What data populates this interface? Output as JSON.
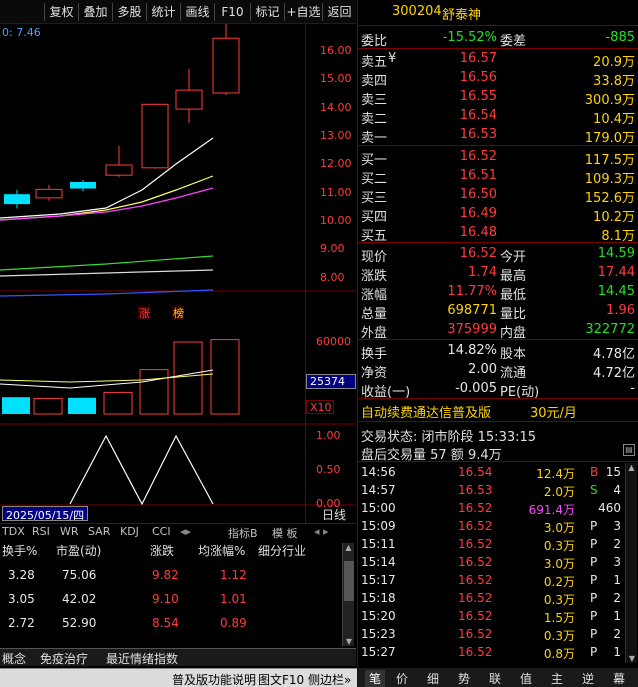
{
  "toolbar": {
    "buttons": [
      "复权",
      "叠加",
      "多股",
      "统计",
      "画线",
      "F10",
      "标记",
      "+自选",
      "返回"
    ]
  },
  "chart_data": [
    {
      "type": "candlestick",
      "title": "",
      "ma_readout": "0: 7.46",
      "yticks": [
        "16.00",
        "15.00",
        "14.00",
        "13.00",
        "12.00",
        "11.00",
        "10.00",
        "9.00",
        "8.00"
      ],
      "ylim": [
        7.5,
        16.6
      ],
      "high_label": "17.44",
      "candles": [
        {
          "o": 10.6,
          "c": 10.95,
          "h": 11.1,
          "l": 10.45,
          "color": "cyan"
        },
        {
          "o": 10.82,
          "c": 11.12,
          "h": 11.28,
          "l": 10.72,
          "color": "red"
        },
        {
          "o": 11.15,
          "c": 11.38,
          "h": 11.45,
          "l": 11.05,
          "color": "cyan"
        },
        {
          "o": 11.62,
          "c": 11.98,
          "h": 12.65,
          "l": 11.55,
          "color": "red"
        },
        {
          "o": 11.88,
          "c": 14.12,
          "h": 14.15,
          "l": 11.85,
          "color": "red"
        },
        {
          "o": 13.95,
          "c": 14.62,
          "h": 15.38,
          "l": 13.45,
          "color": "red"
        },
        {
          "o": 14.52,
          "c": 16.45,
          "h": 17.44,
          "l": 14.45,
          "color": "red"
        }
      ],
      "markers": [
        "涨",
        "榜"
      ]
    },
    {
      "type": "bar",
      "title": "",
      "yticks": [
        "60000"
      ],
      "ylim": [
        0,
        75000
      ],
      "current_readout": "25374",
      "unit_label": "X10",
      "values": [
        14000,
        13000,
        13500,
        18000,
        37000,
        60000,
        62000
      ],
      "colors": [
        "cyan",
        "red",
        "cyan",
        "red",
        "red",
        "red",
        "red"
      ]
    },
    {
      "type": "line",
      "title": "",
      "yticks": [
        "1.00",
        "0.50",
        "0.00"
      ],
      "ylim": [
        0,
        1
      ],
      "values": [
        0,
        1,
        0,
        1,
        0
      ]
    }
  ],
  "date_box": "2025/05/15/四",
  "day_button": "日线",
  "indicator_tabs": [
    "TDX",
    "RSI",
    "WR",
    "SAR",
    "KDJ",
    "CCI",
    "指标B",
    "模 板"
  ],
  "list": {
    "headers": [
      "换手%",
      "市盈(动)",
      "涨跌",
      "均涨幅%",
      "细分行业"
    ],
    "rows": [
      [
        "3.28",
        "75.06",
        "9.82",
        "1.12"
      ],
      [
        "3.05",
        "42.02",
        "9.10",
        "1.01"
      ],
      [
        "2.72",
        "52.90",
        "8.54",
        "0.89"
      ]
    ]
  },
  "bottom_tabs": [
    "概念",
    "免疫治疗",
    "最近情绪指数"
  ],
  "status_bar": {
    "text": "普及版功能说明",
    "f10": "图文F10",
    "sidebar": "侧边栏»"
  },
  "quote": {
    "code": "300204",
    "name": "舒泰神",
    "wei_bi_label": "委比",
    "wei_bi": "-15.52%",
    "wei_cha_label": "委差",
    "wei_cha": "-885",
    "asks": [
      {
        "label": "卖五",
        "mark": "¥",
        "price": "16.57",
        "vol": "20.9万"
      },
      {
        "label": "卖四",
        "price": "16.56",
        "vol": "33.8万"
      },
      {
        "label": "卖三",
        "price": "16.55",
        "vol": "300.9万"
      },
      {
        "label": "卖二",
        "price": "16.54",
        "vol": "10.4万"
      },
      {
        "label": "卖一",
        "price": "16.53",
        "vol": "179.0万"
      }
    ],
    "bids": [
      {
        "label": "买一",
        "price": "16.52",
        "vol": "117.5万"
      },
      {
        "label": "买二",
        "price": "16.51",
        "vol": "109.3万"
      },
      {
        "label": "买三",
        "price": "16.50",
        "vol": "152.6万"
      },
      {
        "label": "买四",
        "price": "16.49",
        "vol": "10.2万"
      },
      {
        "label": "买五",
        "price": "16.48",
        "vol": "8.1万"
      }
    ],
    "stats": [
      {
        "l1": "现价",
        "v1": "16.52",
        "c1": "red",
        "l2": "今开",
        "v2": "14.59",
        "c2": "green"
      },
      {
        "l1": "涨跌",
        "v1": "1.74",
        "c1": "red",
        "l2": "最高",
        "v2": "17.44",
        "c2": "red"
      },
      {
        "l1": "涨幅",
        "v1": "11.77%",
        "c1": "red",
        "l2": "最低",
        "v2": "14.45",
        "c2": "green"
      },
      {
        "l1": "总量",
        "v1": "698771",
        "c1": "yellow",
        "l2": "量比",
        "v2": "1.96",
        "c2": "red"
      },
      {
        "l1": "外盘",
        "v1": "375999",
        "c1": "red",
        "l2": "内盘",
        "v2": "322772",
        "c2": "green"
      }
    ],
    "fin": [
      {
        "l1": "换手",
        "v1": "14.82%",
        "l2": "股本",
        "v2": "4.78亿"
      },
      {
        "l1": "净资",
        "v1": "2.00",
        "l2": "流通",
        "v2": "4.72亿"
      },
      {
        "l1": "收益(一)",
        "v1": "-0.005",
        "l2": "PE(动)",
        "v2": "-"
      }
    ],
    "promo": "自动续费通达信普及版",
    "promo_price": "30元/月",
    "trade_status": "交易状态: 闭市阶段 15:33:15",
    "after_hours": "盘后交易量 57 额 9.4万"
  },
  "ticks": [
    {
      "t": "14:56",
      "p": "16.54",
      "v": "12.4万",
      "bs": "B",
      "n": "15",
      "vc": "yellow",
      "bsc": "red"
    },
    {
      "t": "14:57",
      "p": "16.53",
      "v": "2.0万",
      "bs": "S",
      "n": "4",
      "vc": "yellow",
      "bsc": "green"
    },
    {
      "t": "15:00",
      "p": "16.52",
      "v": "691.4万",
      "bs": "",
      "n": "460",
      "vc": "magenta",
      "bsc": "white"
    },
    {
      "t": "15:09",
      "p": "16.52",
      "v": "3.0万",
      "bs": "P",
      "n": "3",
      "vc": "yellow",
      "bsc": "white"
    },
    {
      "t": "15:11",
      "p": "16.52",
      "v": "0.3万",
      "bs": "P",
      "n": "2",
      "vc": "yellow",
      "bsc": "white"
    },
    {
      "t": "15:14",
      "p": "16.52",
      "v": "3.0万",
      "bs": "P",
      "n": "3",
      "vc": "yellow",
      "bsc": "white"
    },
    {
      "t": "15:17",
      "p": "16.52",
      "v": "0.2万",
      "bs": "P",
      "n": "1",
      "vc": "yellow",
      "bsc": "white"
    },
    {
      "t": "15:18",
      "p": "16.52",
      "v": "0.3万",
      "bs": "P",
      "n": "2",
      "vc": "yellow",
      "bsc": "white"
    },
    {
      "t": "15:20",
      "p": "16.52",
      "v": "1.5万",
      "bs": "P",
      "n": "1",
      "vc": "yellow",
      "bsc": "white"
    },
    {
      "t": "15:23",
      "p": "16.52",
      "v": "0.3万",
      "bs": "P",
      "n": "2",
      "vc": "yellow",
      "bsc": "white"
    },
    {
      "t": "15:27",
      "p": "16.52",
      "v": "0.8万",
      "bs": "P",
      "n": "1",
      "vc": "yellow",
      "bsc": "white"
    }
  ],
  "right_tabs": [
    "笔",
    "价",
    "细",
    "势",
    "联",
    "值",
    "主",
    "逆",
    "幕"
  ]
}
